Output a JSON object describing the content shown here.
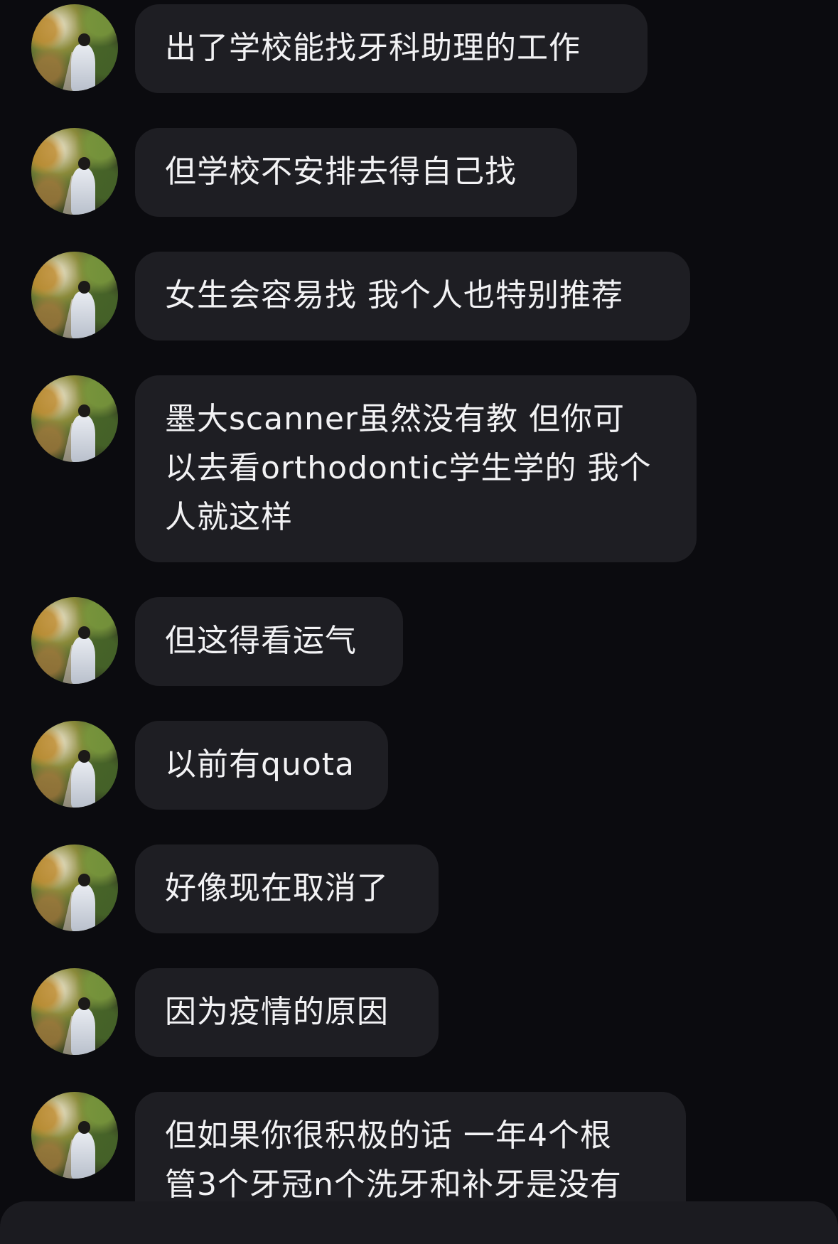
{
  "messages": [
    {
      "text": "出了学校能找牙科助理的工作"
    },
    {
      "text": "但学校不安排去得自己找"
    },
    {
      "text": "女生会容易找 我个人也特别推荐"
    },
    {
      "text": "墨大scanner虽然没有教 但你可\n以去看orthodontic学生学的 我个\n人就这样"
    },
    {
      "text": "但这得看运气"
    },
    {
      "text": "以前有quota"
    },
    {
      "text": "好像现在取消了"
    },
    {
      "text": "因为疫情的原因"
    },
    {
      "text": "但如果你很积极的话 一年4个根\n管3个牙冠n个洗牙和补牙是没有"
    }
  ]
}
